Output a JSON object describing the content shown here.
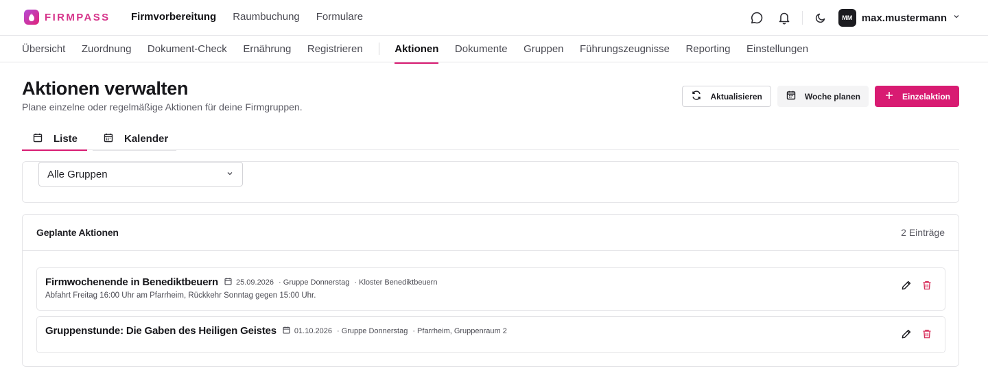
{
  "app": {
    "brand": "FIRMPASS",
    "brand_color": "#d6338a",
    "accent_color": "#d81b72"
  },
  "topnav": [
    {
      "label": "Firmvorbereitung",
      "active": true
    },
    {
      "label": "Raumbuchung",
      "active": false
    },
    {
      "label": "Formulare",
      "active": false
    }
  ],
  "header_right": {
    "icons": [
      "chat-bubble-icon",
      "bell-icon",
      "moon-icon"
    ],
    "avatar_initials": "MM",
    "username": "max.mustermann"
  },
  "subnav": {
    "group1": [
      "Übersicht",
      "Zuordnung",
      "Dokument-Check",
      "Ernährung",
      "Registrieren"
    ],
    "group2": [
      "Aktionen",
      "Dokumente",
      "Gruppen",
      "Führungszeugnisse",
      "Reporting",
      "Einstellungen"
    ],
    "active": "Aktionen"
  },
  "page": {
    "title": "Aktionen verwalten",
    "subtitle": "Plane einzelne oder regelmäßige Aktionen für deine Firmgruppen."
  },
  "actions": {
    "refresh": "Aktualisieren",
    "plan_week": "Woche planen",
    "single_action": "Einzelaktion"
  },
  "view_tabs": [
    {
      "label": "Liste",
      "active": true
    },
    {
      "label": "Kalender",
      "active": false
    }
  ],
  "filter": {
    "group_select": "Alle Gruppen"
  },
  "list": {
    "title": "Geplante Aktionen",
    "count": "2 Einträge",
    "items": [
      {
        "title": "Firmwochenende in Benediktbeuern",
        "date": "25.09.2026",
        "group": "· Gruppe Donnerstag",
        "location": "· Kloster Benediktbeuern",
        "description": "Abfahrt Freitag 16:00 Uhr am Pfarrheim, Rückkehr Sonntag gegen 15:00 Uhr."
      },
      {
        "title": "Gruppenstunde: Die Gaben des Heiligen Geistes",
        "date": "01.10.2026",
        "group": "· Gruppe Donnerstag",
        "location": "· Pfarrheim, Gruppenraum 2",
        "description": ""
      }
    ]
  }
}
